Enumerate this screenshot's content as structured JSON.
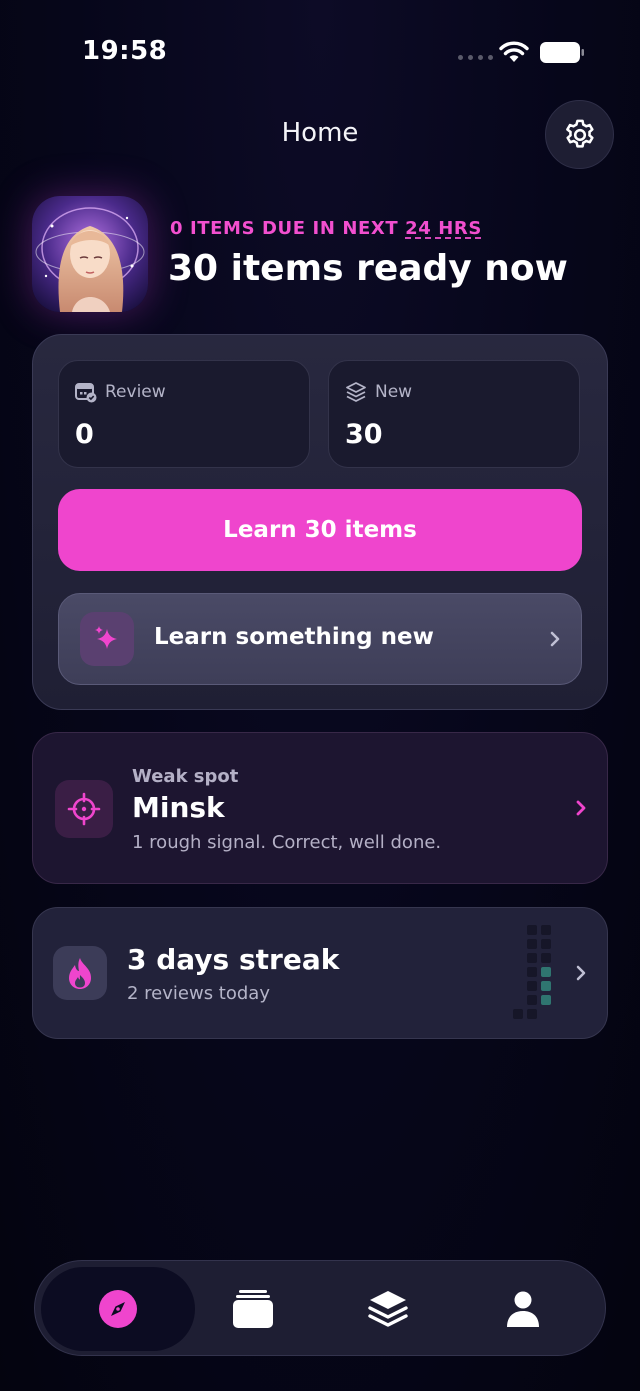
{
  "status_bar": {
    "time": "19:58"
  },
  "header": {
    "title": "Home"
  },
  "hero": {
    "due_prefix": "0 ITEMS DUE IN NEXT ",
    "due_highlight": "24 HRS",
    "ready_title": "30 items ready now"
  },
  "stats": {
    "review": {
      "label": "Review",
      "value": "0"
    },
    "new": {
      "label": "New",
      "value": "30"
    }
  },
  "actions": {
    "learn_label": "Learn 30 items",
    "discover_label": "Learn something new"
  },
  "weak_spot": {
    "label": "Weak spot",
    "title": "Minsk",
    "description": "1 rough signal. Correct, well done."
  },
  "streak": {
    "title": "3 days streak",
    "subtitle": "2 reviews today"
  },
  "tabs": [
    {
      "icon": "compass-icon",
      "active": true
    },
    {
      "icon": "cards-icon",
      "active": false
    },
    {
      "icon": "layers-icon",
      "active": false
    },
    {
      "icon": "person-icon",
      "active": false
    }
  ],
  "colors": {
    "accent": "#ef45cd",
    "background": "#06061a",
    "card": "#22223a",
    "streak_active": "#2f7570"
  }
}
